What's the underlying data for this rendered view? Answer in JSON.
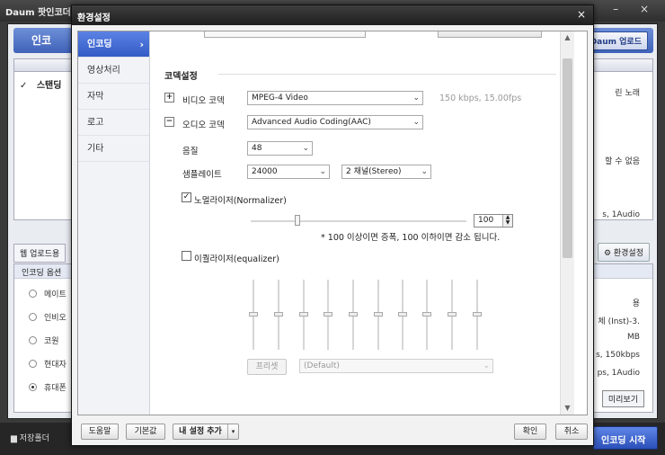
{
  "background_app": {
    "title": "Daum 팟인코더 ▾",
    "window_controls": "– ×",
    "logo_text": "인코",
    "upload_button": "Daum 업로드",
    "list_row": "스탠딩",
    "right_texts": [
      "린 노래",
      "할 수 없음",
      "s, 1Audio"
    ],
    "web_upload_tab": "웹 업로드용",
    "settings_button": "환경설정",
    "options_header": "인코딩 옵션",
    "options": [
      "메이트",
      "인비오",
      "코원",
      "현대자",
      "휴대폰"
    ],
    "selected_option_index": 4,
    "options_right": [
      "용",
      "체 (Inst)-3.",
      "MB",
      "s, 150kbps",
      "ps, 1Audio"
    ],
    "more_button": "미리보기",
    "save_folder": "저장폴더",
    "start_button": "인코딩 시작"
  },
  "dialog": {
    "title": "환경설정",
    "close_icon": "×",
    "nav": [
      {
        "label": "인코딩",
        "active": true
      },
      {
        "label": "영상처리"
      },
      {
        "label": "자막"
      },
      {
        "label": "로고"
      },
      {
        "label": "기타"
      }
    ],
    "nav_active_chevron": "›",
    "codec_section_title": "코덱설정",
    "video_codec": {
      "toggle": "+",
      "label": "비디오 코덱",
      "value": "MPEG-4 Video",
      "info": "150 kbps, 15.00fps"
    },
    "audio_codec": {
      "toggle": "−",
      "label": "오디오 코덱",
      "value": "Advanced Audio Coding(AAC)"
    },
    "quality": {
      "label": "음질",
      "value": "48"
    },
    "sample_rate": {
      "label": "샘플레이트",
      "value": "24000",
      "channels": "2 채널(Stereo)"
    },
    "normalizer": {
      "checked": true,
      "label": "노멀라이저(Normalizer)",
      "value": "100",
      "level": 100,
      "hint": "* 100 이상이면 증폭, 100 이하이면 감소 됩니다."
    },
    "equalizer": {
      "checked": false,
      "label": "이퀄라이저(equalizer)",
      "band_count": 10,
      "preset_button": "프리셋",
      "preset_value": "(Default)"
    },
    "footer": {
      "help": "도움말",
      "defaults": "기본값",
      "add_my_settings": "내 설정 추가",
      "ok": "확인",
      "cancel": "취소"
    }
  }
}
